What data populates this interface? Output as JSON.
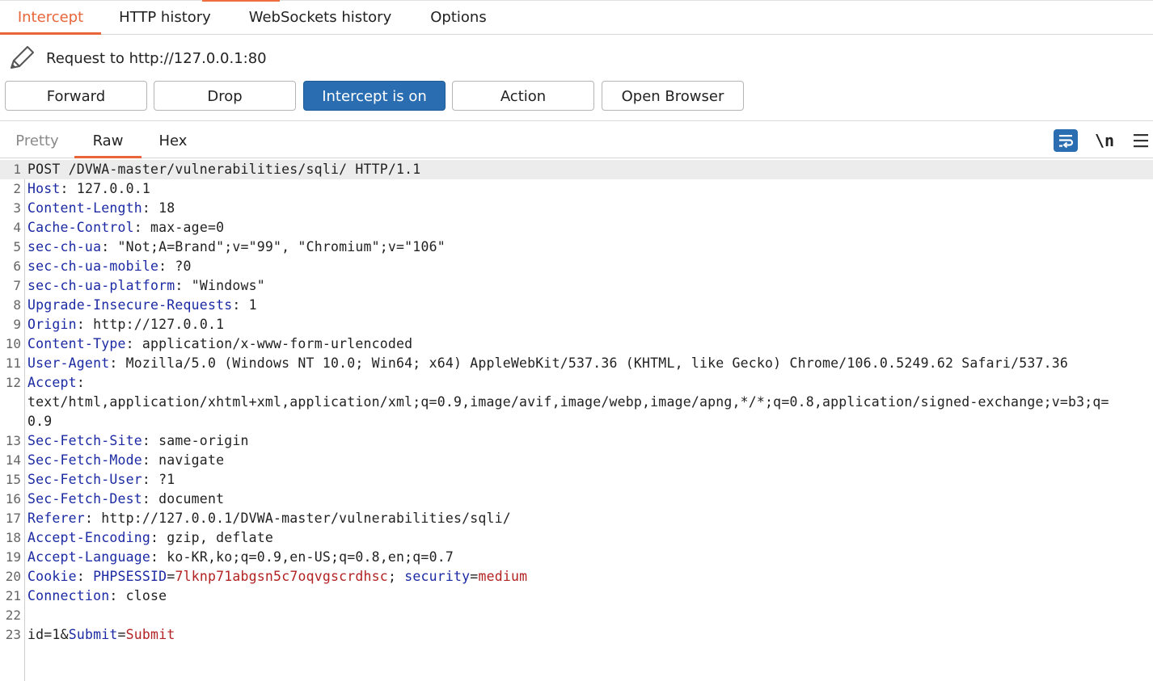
{
  "tabs": [
    "Intercept",
    "HTTP history",
    "WebSockets history",
    "Options"
  ],
  "request_label": "Request to http://127.0.0.1:80",
  "buttons": {
    "forward": "Forward",
    "drop": "Drop",
    "intercept": "Intercept is on",
    "action": "Action",
    "open_browser": "Open Browser"
  },
  "editor_tabs": [
    "Pretty",
    "Raw",
    "Hex"
  ],
  "newline_toggle": "\\n",
  "lines": [
    {
      "n": "1",
      "k": "",
      "v": "POST /DVWA-master/vulnerabilities/sqli/ HTTP/1.1"
    },
    {
      "n": "2",
      "k": "Host",
      "v": ": 127.0.0.1"
    },
    {
      "n": "3",
      "k": "Content-Length",
      "v": ": 18"
    },
    {
      "n": "4",
      "k": "Cache-Control",
      "v": ": max-age=0"
    },
    {
      "n": "5",
      "k": "sec-ch-ua",
      "v": ": \"Not;A=Brand\";v=\"99\", \"Chromium\";v=\"106\""
    },
    {
      "n": "6",
      "k": "sec-ch-ua-mobile",
      "v": ": ?0"
    },
    {
      "n": "7",
      "k": "sec-ch-ua-platform",
      "v": ": \"Windows\""
    },
    {
      "n": "8",
      "k": "Upgrade-Insecure-Requests",
      "v": ": 1"
    },
    {
      "n": "9",
      "k": "Origin",
      "v": ": http://127.0.0.1"
    },
    {
      "n": "10",
      "k": "Content-Type",
      "v": ": application/x-www-form-urlencoded"
    },
    {
      "n": "11",
      "k": "User-Agent",
      "v": ": Mozilla/5.0 (Windows NT 10.0; Win64; x64) AppleWebKit/537.36 (KHTML, like Gecko) Chrome/106.0.5249.62 Safari/537.36"
    },
    {
      "n": "12",
      "k": "Accept",
      "v": ":"
    },
    {
      "n": "",
      "k": "",
      "v": "text/html,application/xhtml+xml,application/xml;q=0.9,image/avif,image/webp,image/apng,*/*;q=0.8,application/signed-exchange;v=b3;q="
    },
    {
      "n": "",
      "k": "",
      "v": "0.9"
    },
    {
      "n": "13",
      "k": "Sec-Fetch-Site",
      "v": ": same-origin"
    },
    {
      "n": "14",
      "k": "Sec-Fetch-Mode",
      "v": ": navigate"
    },
    {
      "n": "15",
      "k": "Sec-Fetch-User",
      "v": ": ?1"
    },
    {
      "n": "16",
      "k": "Sec-Fetch-Dest",
      "v": ": document"
    },
    {
      "n": "17",
      "k": "Referer",
      "v": ": http://127.0.0.1/DVWA-master/vulnerabilities/sqli/"
    },
    {
      "n": "18",
      "k": "Accept-Encoding",
      "v": ": gzip, deflate"
    },
    {
      "n": "19",
      "k": "Accept-Language",
      "v": ": ko-KR,ko;q=0.9,en-US;q=0.8,en;q=0.7"
    },
    {
      "n": "20",
      "k": "Cookie",
      "v": ": ",
      "cookies": [
        {
          "name": "PHPSESSID",
          "value": "7lknp71abgsn5c7oqvgscrdhsc"
        },
        {
          "name": "security",
          "value": "medium"
        }
      ]
    },
    {
      "n": "21",
      "k": "Connection",
      "v": ": close"
    },
    {
      "n": "22",
      "k": "",
      "v": ""
    },
    {
      "n": "23",
      "k": "",
      "v": "",
      "body": [
        {
          "name": "id",
          "value": "1",
          "style": "plain"
        },
        {
          "name": "Submit",
          "value": "Submit",
          "style": "colored"
        }
      ]
    }
  ],
  "colors": {
    "accent": "#e8663a",
    "primary": "#2a6db0",
    "header_key": "#1b2aa3",
    "param_value": "#b22222"
  }
}
